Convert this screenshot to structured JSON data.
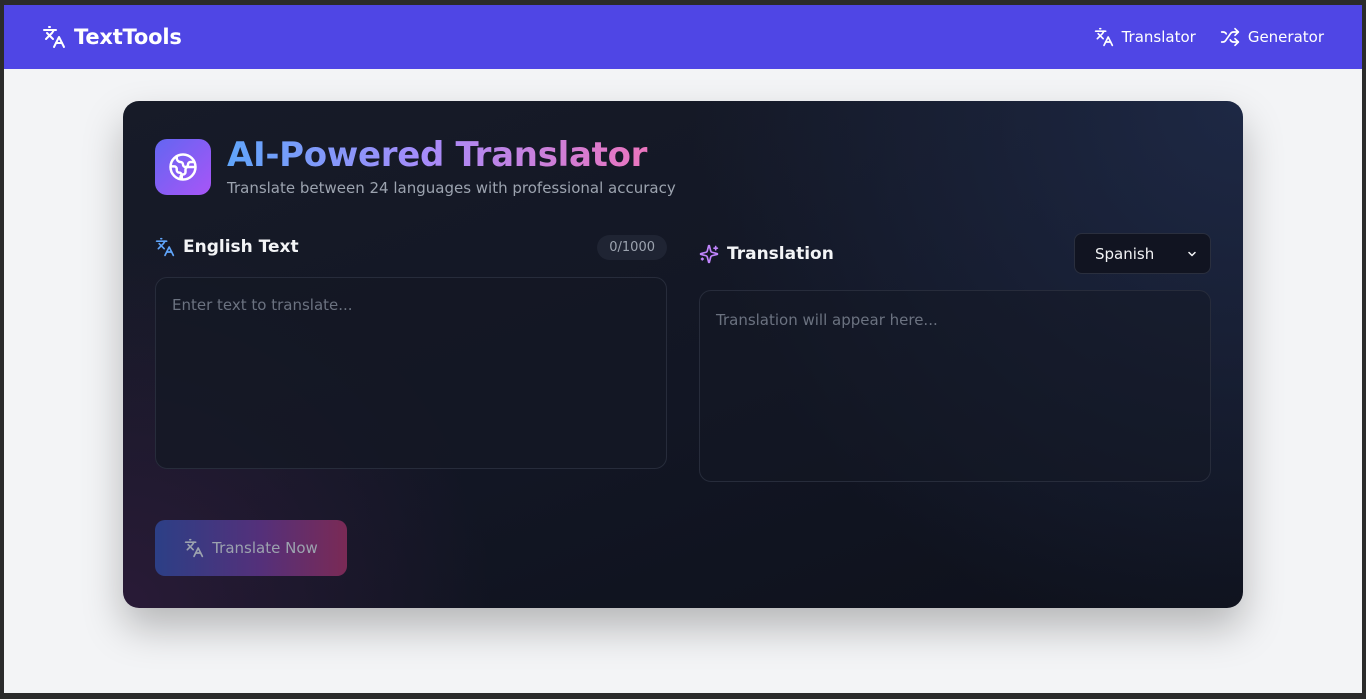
{
  "navbar": {
    "brand": "TextTools",
    "links": [
      {
        "label": "Translator",
        "icon": "translate-icon"
      },
      {
        "label": "Generator",
        "icon": "shuffle-icon"
      }
    ]
  },
  "header": {
    "title": "AI-Powered Translator",
    "subtitle": "Translate between 24 languages with professional accuracy"
  },
  "source": {
    "title": "English Text",
    "counter": "0/1000",
    "placeholder": "Enter text to translate..."
  },
  "target": {
    "title": "Translation",
    "language": "Spanish",
    "placeholder": "Translation will appear here..."
  },
  "action": {
    "label": "Translate Now"
  },
  "colors": {
    "nav": "#4f46e5",
    "accent_blue": "#60a5fa",
    "accent_purple": "#a78bfa",
    "accent_pink": "#f472b6"
  }
}
